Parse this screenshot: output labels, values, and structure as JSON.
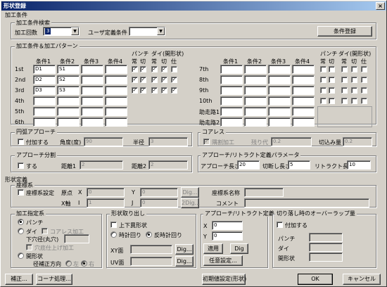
{
  "window": {
    "title": "形状登録"
  },
  "processing": {
    "title": "加工条件",
    "search": {
      "title": "加工条件検索",
      "count_label": "加工回数",
      "count_value": "3",
      "user_label": "ユーザ定義条件",
      "user_value": "",
      "register_button": "条件登録"
    },
    "grid": {
      "title": "加工条件＆加工パターン",
      "col_headers": [
        "条件1",
        "条件2",
        "条件3",
        "条件4"
      ],
      "punch_group": "パンチ",
      "die_group": "ダイ(開形状)",
      "flag_headers": [
        "常",
        "切",
        "常",
        "切",
        "仕"
      ],
      "left_rows": [
        {
          "label": "1st",
          "c1": "D1",
          "c2": "S1",
          "checks": [
            true,
            true,
            true,
            true,
            false
          ]
        },
        {
          "label": "2nd",
          "c1": "D2",
          "c2": "S2",
          "checks": [
            true,
            true,
            true,
            true,
            true
          ]
        },
        {
          "label": "3rd",
          "c1": "D3",
          "c2": "S3",
          "checks": [
            true,
            true,
            true,
            true,
            true
          ]
        },
        {
          "label": "4th",
          "c1": "",
          "c2": "",
          "checks": [
            false,
            false,
            false,
            false,
            false
          ]
        },
        {
          "label": "5th",
          "c1": "",
          "c2": "",
          "checks": [
            false,
            false,
            false,
            false,
            false
          ]
        },
        {
          "label": "6th",
          "c1": "",
          "c2": "",
          "checks": [
            false,
            false,
            false,
            false,
            false
          ]
        }
      ],
      "right_rows": [
        {
          "label": "7th"
        },
        {
          "label": "8th"
        },
        {
          "label": "9th"
        },
        {
          "label": "10th"
        },
        {
          "label": "助走路1"
        },
        {
          "label": "助走路2"
        }
      ]
    },
    "circle_approach": {
      "title": "円弧アプローチ",
      "add_label": "付加する",
      "angle_label": "角度(度)",
      "angle_value": "90",
      "radius_label": "半径",
      "radius_value": "3"
    },
    "coreless": {
      "title": "コアレス",
      "crack_label": "隅割加工",
      "cut_label": "残り代",
      "cut_value": "0.2",
      "incut_label": "切込み量",
      "incut_value": "0.2"
    },
    "approach_split": {
      "title": "アプローチ分割",
      "do_label": "する",
      "dist1_label": "距離1",
      "dist1_value": "2",
      "dist2_label": "距離2",
      "dist2_value": "2"
    },
    "approach_retract": {
      "title": "アプローチ/リトラクト定義パラメータ",
      "approach_label": "アプローチ長さ",
      "approach_value": "20",
      "cutlen_label": "切断し長さ",
      "cutlen_value": "5",
      "retract_label": "リトラクト長さ",
      "retract_value": "10"
    }
  },
  "shape": {
    "title": "形状定義",
    "coords": {
      "title": "座標系",
      "setting_label": "座標系設定",
      "origin_label": "原点",
      "x_label": "X",
      "x_value": "0",
      "y_label": "Y",
      "y_value": "0",
      "dig1": "Dig...",
      "name_label": "座標系名称",
      "name_value": "",
      "xaxis_label": "X軸",
      "i_label": "I",
      "i_value": "1",
      "j_label": "J",
      "j_value": "0",
      "dig2": "2Dig...",
      "comment_label": "コメント",
      "comment_value": ""
    },
    "proc_def": {
      "title": "加工指定系",
      "punch": "パンチ",
      "die": "ダイ",
      "coreless": "コアレス加工",
      "bottom": "下穴径(丸穴)",
      "bottom_value": "",
      "finish": "穴底仕上げ加工",
      "open": "開形状",
      "direction": "径補正方向",
      "left": "左",
      "right": "右"
    },
    "shape_cut": {
      "title": "形状取り出し",
      "updown": "上下異形状",
      "cw": "時計回り",
      "ccw": "反時計回り",
      "xy_label": "XY面",
      "xy_value": "",
      "dig_xy": "Dig...",
      "uv_label": "UV面",
      "uv_value": "",
      "dig_uv": "Dig..."
    },
    "ar_def": {
      "title": "アプローチ/リトラクト定義",
      "x_label": "X",
      "x_value": "0",
      "y_label": "Y",
      "y_value": "0",
      "apply": "適用",
      "dig": "Dig",
      "custom": "任意設定..."
    },
    "overlap": {
      "title": "切り落し時のオーバーラップ量",
      "add": "付加する",
      "punch": "パンチ",
      "punch_value": "",
      "die": "ダイ",
      "die_value": "",
      "open": "開形状",
      "open_value": ""
    }
  },
  "footer": {
    "correct": "補正...",
    "corner": "コーナ処理...",
    "init": "初期値設定(形状)",
    "ok": "OK",
    "cancel": "キャンセル"
  }
}
